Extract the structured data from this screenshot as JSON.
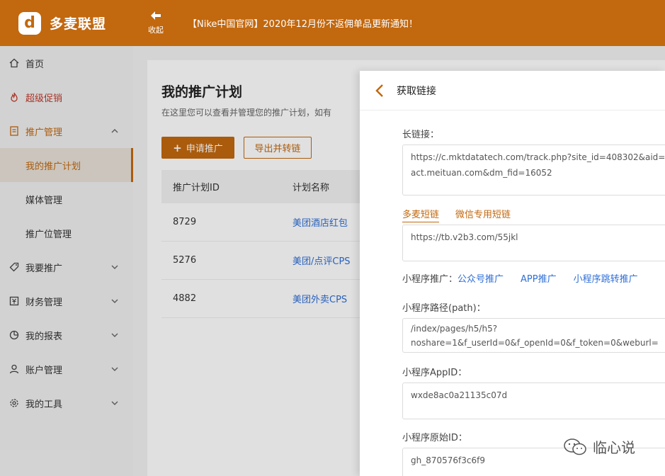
{
  "header": {
    "logo_letter": "d",
    "app_name": "多麦联盟",
    "collapse_label": "收起",
    "notice": "【Nike中国官网】2020年12月份不返佣单品更新通知！",
    "brand_color": "#c2680e"
  },
  "sidebar": {
    "items": [
      {
        "label": "首页",
        "icon": "home-icon"
      },
      {
        "label": "超级促销",
        "icon": "flame-icon"
      },
      {
        "label": "推广管理",
        "icon": "document-icon"
      },
      {
        "label": "我要推广",
        "icon": "tag-icon"
      },
      {
        "label": "财务管理",
        "icon": "finance-icon"
      },
      {
        "label": "我的报表",
        "icon": "pie-chart-icon"
      },
      {
        "label": "账户管理",
        "icon": "user-icon"
      },
      {
        "label": "我的工具",
        "icon": "gear-icon"
      }
    ],
    "sub_items": [
      {
        "label": "我的推广计划"
      },
      {
        "label": "媒体管理"
      },
      {
        "label": "推广位管理"
      }
    ]
  },
  "main": {
    "title": "我的推广计划",
    "description": "在这里您可以查看并管理您的推广计划，如有",
    "apply_button": "申请推广",
    "export_button": "导出并转链",
    "columns": [
      "推广计划ID",
      "计划名称"
    ],
    "rows": [
      {
        "id": "8729",
        "name": "美团酒店红包"
      },
      {
        "id": "5276",
        "name": "美团/点评CPS"
      },
      {
        "id": "4882",
        "name": "美团外卖CPS"
      }
    ]
  },
  "drawer": {
    "title": "获取链接",
    "long_link_label": "长链接：",
    "long_link_value_line1": "https://c.mktdatatech.com/track.php?site_id=408302&aid=",
    "long_link_value_line2": "act.meituan.com&dm_fid=16052",
    "tabs": [
      "多麦短链",
      "微信专用短链"
    ],
    "short_link_value": "https://tb.v2b3.com/55jkl",
    "mini_program_label": "小程序推广：",
    "mini_program_links": [
      "公众号推广",
      "APP推广",
      "小程序跳转推广"
    ],
    "path_label": "小程序路径(path)：",
    "path_value_line1": "/index/pages/h5/h5?",
    "path_value_line2": "noshare=1&f_userId=0&f_openId=0&f_token=0&weburl=",
    "appid_label": "小程序AppID：",
    "appid_value": "wxde8ac0a21135c07d",
    "origin_id_label": "小程序原始ID：",
    "origin_id_value": "gh_870576f3c6f9"
  },
  "watermark": {
    "text": "临心说"
  }
}
